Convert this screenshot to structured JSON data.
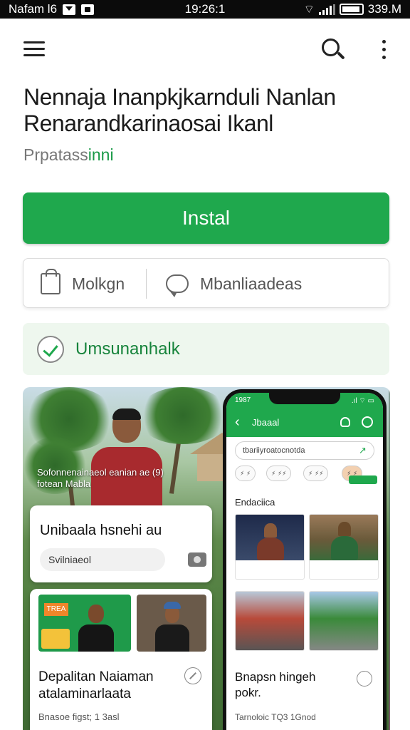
{
  "status_bar": {
    "carrier": "Nafam l6",
    "time": "19:26:1",
    "battery": "339.M"
  },
  "toolbar": {
    "menu_icon": "menu-icon",
    "search_icon": "search-icon",
    "more_icon": "more-vert-icon"
  },
  "app": {
    "title": "Nennaja Inanpkjkarnduli Nanlan Renarandkarinaosai Ikanl",
    "subtitle_prefix": "Prpatass",
    "subtitle_accent": "inni",
    "install_label": "Instal",
    "actions": [
      {
        "label": "Molkgn",
        "icon": "shopping-bag-icon"
      },
      {
        "label": "Mbanliaadeas",
        "icon": "chat-bubble-icon"
      }
    ],
    "verified_label": "Umsunanhalk"
  },
  "preview": {
    "caption": "Sofonnenainaeol eanian ae (9) fotean Mabla",
    "card1": {
      "title": "Unibaala hsnehi au",
      "pill": "Svilniaeol"
    },
    "card2": {
      "title": "Depalitan Naiaman atalaminarlaata",
      "meta": "Bnasoe figst; 1 3asl",
      "tag": "TREA"
    },
    "phone": {
      "status_time": "1987",
      "status_right": ".ıl ⌔ ▭",
      "back": "‹",
      "title": "Jbaaal",
      "search_text": "tbariiyroatocnotda",
      "chips": [
        "⚡ ⚡",
        "⚡ ⚡⚡",
        "⚡ ⚡⚡",
        "⚡ ⚡"
      ],
      "chip_badge": "",
      "section_title": "Endaciica",
      "card_title": "Bnapsn hingeh pokr.",
      "card_meta": "Tarnoloic TQ3 1Gnod"
    }
  },
  "colors": {
    "accent": "#1fa84d",
    "verified_bg": "#eef7ee",
    "verified_text": "#17843c"
  }
}
